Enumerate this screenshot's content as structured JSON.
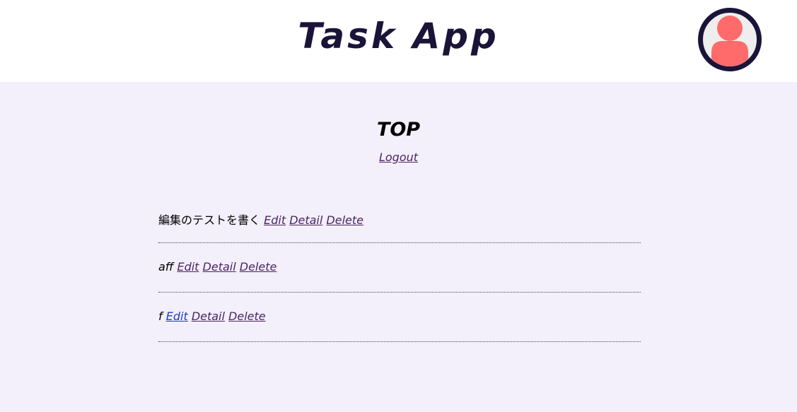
{
  "header": {
    "title": "Task App",
    "avatar_icon": "user-avatar-icon",
    "colors": {
      "title": "#1b1438",
      "avatar_border": "#1b1438",
      "avatar_figure": "#ff6b6b"
    }
  },
  "main": {
    "heading": "TOP",
    "logout_label": "Logout",
    "background": "#f3effb"
  },
  "tasks": [
    {
      "title": "編集のテストを書く",
      "edit": "Edit",
      "detail": "Detail",
      "delete": "Delete"
    },
    {
      "title": "aff",
      "edit": "Edit",
      "detail": "Detail",
      "delete": "Delete"
    },
    {
      "title": "f",
      "edit": "Edit",
      "detail": "Detail",
      "delete": "Delete"
    }
  ]
}
